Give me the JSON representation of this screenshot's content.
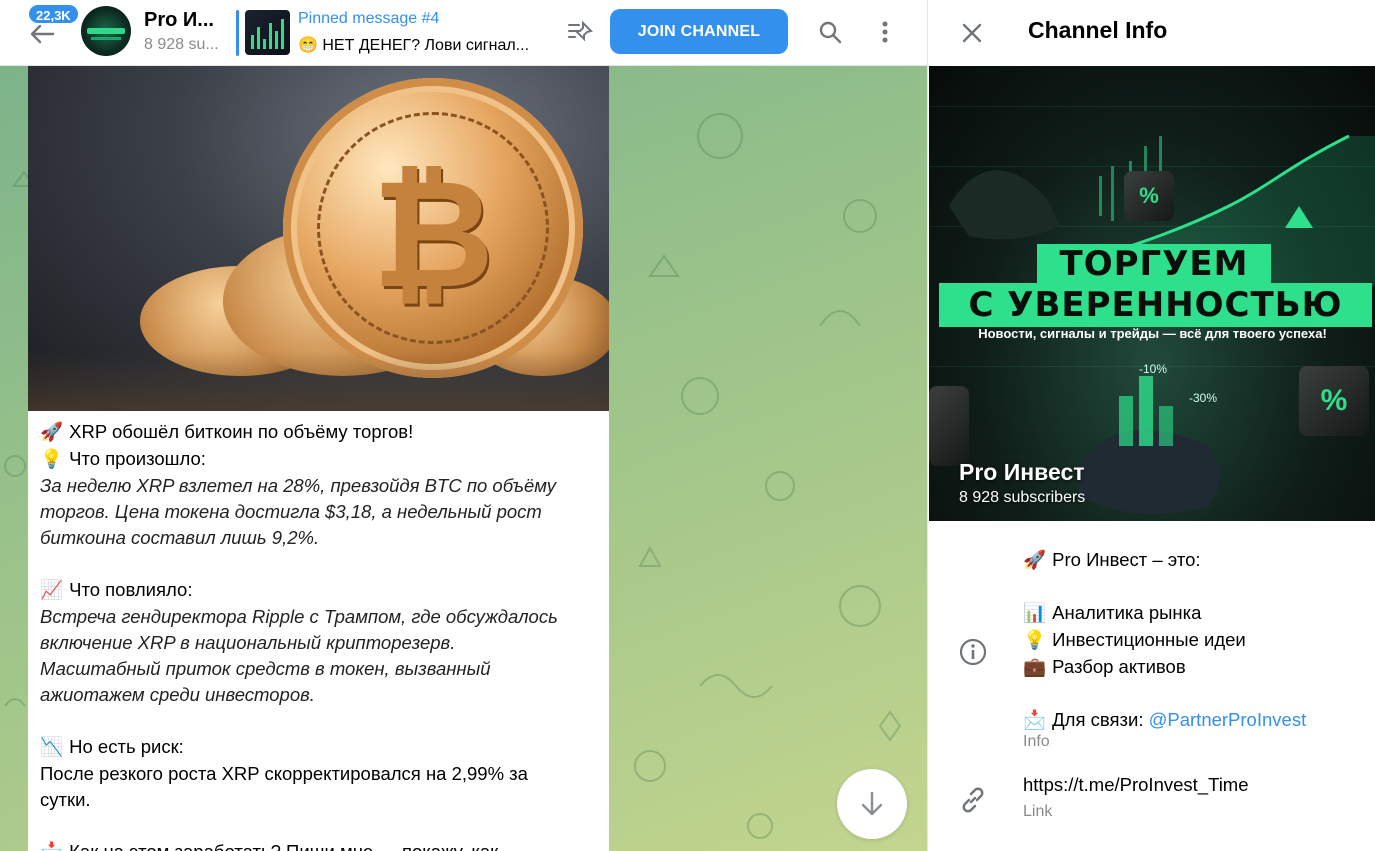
{
  "header": {
    "unread_badge": "22,3K",
    "title": "Pro И...",
    "subtitle": "8 928 su...",
    "pinned_title": "Pinned message #4",
    "pinned_text": "😁 НЕТ ДЕНЕГ? Лови сигнал...",
    "join_label": "JOIN CHANNEL",
    "icons": [
      "back-arrow-icon",
      "unpin-icon",
      "search-icon",
      "more-vertical-icon"
    ]
  },
  "message": {
    "lines": [
      {
        "emoji": "🚀",
        "text": "XRP обошёл биткоин по объёму торгов!",
        "style": "normal"
      },
      {
        "emoji": "💡",
        "text": "Что произошло:",
        "style": "normal"
      },
      {
        "emoji": "",
        "text": "За неделю XRP взлетел на 28%, превзойдя BTC по объёму",
        "style": "italic"
      },
      {
        "emoji": "",
        "text": "торгов. Цена токена достигла $3,18, а недельный рост",
        "style": "italic"
      },
      {
        "emoji": "",
        "text": "биткоина составил лишь 9,2%.",
        "style": "italic"
      },
      {
        "emoji": "",
        "text": "",
        "style": "normal"
      },
      {
        "emoji": "📈",
        "text": "Что повлияло:",
        "style": "normal"
      },
      {
        "emoji": "",
        "text": "Встреча гендиректора Ripple с Трампом, где обсуждалось",
        "style": "italic"
      },
      {
        "emoji": "",
        "text": "включение XRP в национальный крипторезерв.",
        "style": "italic"
      },
      {
        "emoji": "",
        "text": "Масштабный приток средств в токен, вызванный",
        "style": "italic"
      },
      {
        "emoji": "",
        "text": "ажиотажем среди инвесторов.",
        "style": "italic"
      },
      {
        "emoji": "",
        "text": "",
        "style": "normal"
      },
      {
        "emoji": "📉",
        "text": "Но есть риск:",
        "style": "normal"
      },
      {
        "emoji": "",
        "text": "После резкого роста XRP скорректировался на 2,99% за",
        "style": "normal"
      },
      {
        "emoji": "",
        "text": "сутки.",
        "style": "normal"
      },
      {
        "emoji": "",
        "text": "",
        "style": "normal"
      },
      {
        "emoji": "📩",
        "text": "Как на этом заработать? Пиши мне — покажу, как",
        "style": "normal"
      }
    ]
  },
  "info": {
    "title": "Channel Info",
    "banner": {
      "headline_1": "ТОРГУЕМ",
      "headline_2": "С УВЕРЕННОСТЬЮ",
      "tagline": "Новости, сигналы и трейды — всё для твоего успеха!",
      "pct_a": "-10%",
      "pct_b": "-30%",
      "name": "Pro Инвест",
      "subscribers": "8 928 subscribers"
    },
    "description": {
      "intro": "Pro Инвест – это:",
      "items": [
        {
          "emoji": "📊",
          "text": "Аналитика рынка"
        },
        {
          "emoji": "💡",
          "text": "Инвестиционные идеи"
        },
        {
          "emoji": "💼",
          "text": "Разбор активов"
        }
      ],
      "contact_emoji": "📩",
      "contact_label": "Для связи: ",
      "contact_handle": "@PartnerProInvest",
      "label": "Info"
    },
    "link": {
      "url": "https://t.me/ProInvest_Time",
      "label": "Link"
    }
  },
  "colors": {
    "accent": "#3390ec",
    "banner_green": "#2ee08c",
    "muted": "#8a8a8a"
  }
}
